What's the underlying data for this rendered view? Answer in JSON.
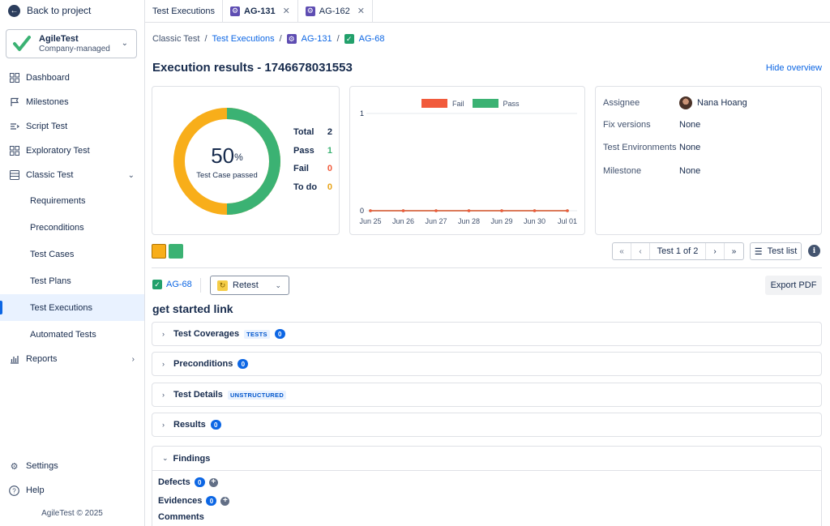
{
  "sidebar": {
    "back_label": "Back to project",
    "project_name": "AgileTest",
    "project_type": "Company-managed",
    "items": [
      {
        "label": "Dashboard",
        "icon": "dashboard-icon"
      },
      {
        "label": "Milestones",
        "icon": "flag-icon"
      },
      {
        "label": "Script Test",
        "icon": "script-icon"
      },
      {
        "label": "Exploratory Test",
        "icon": "grid-icon"
      },
      {
        "label": "Classic Test",
        "icon": "table-icon"
      }
    ],
    "sub_items": [
      "Requirements",
      "Preconditions",
      "Test Cases",
      "Test Plans",
      "Test Executions",
      "Automated Tests"
    ],
    "active_sub": "Test Executions",
    "reports_label": "Reports",
    "settings_label": "Settings",
    "help_label": "Help",
    "copyright": "AgileTest © 2025"
  },
  "tabs": [
    {
      "label": "Test Executions"
    },
    {
      "label": "AG-131"
    },
    {
      "label": "AG-162"
    }
  ],
  "breadcrumb": {
    "root": "Classic Test",
    "section": "Test Executions",
    "parent": "AG-131",
    "current": "AG-68"
  },
  "page": {
    "title": "Execution results - 1746678031553",
    "hide_overview": "Hide overview"
  },
  "summary": {
    "percent": "50",
    "percent_sign": "%",
    "caption": "Test Case passed",
    "total_label": "Total",
    "total": "2",
    "pass_label": "Pass",
    "pass": "1",
    "fail_label": "Fail",
    "fail": "0",
    "todo_label": "To do",
    "todo": "0",
    "colors": {
      "pass": "#3bb273",
      "fail": "#f15a3b",
      "todo": "#f8ae1a"
    }
  },
  "chart_data": {
    "type": "line",
    "x": [
      "Jun 25",
      "Jun 26",
      "Jun 27",
      "Jun 28",
      "Jun 29",
      "Jun 30",
      "Jul 01"
    ],
    "series": [
      {
        "name": "Fail",
        "values": [
          0,
          0,
          0,
          0,
          0,
          0,
          0
        ],
        "color": "#f15a3b"
      },
      {
        "name": "Pass",
        "values": [
          0,
          0,
          0,
          0,
          0,
          0,
          0
        ],
        "color": "#3bb273"
      }
    ],
    "yticks": [
      "0",
      "1"
    ],
    "ylim": [
      0,
      1
    ],
    "legend": "top",
    "grid": true
  },
  "info": {
    "assignee_label": "Assignee",
    "assignee": "Nana Hoang",
    "fix_versions_label": "Fix versions",
    "fix_versions": "None",
    "environments_label": "Test Environments",
    "environments": "None",
    "milestone_label": "Milestone",
    "milestone": "None"
  },
  "pager": {
    "text": "Test 1 of 2",
    "test_list": "Test list"
  },
  "detail": {
    "issue_key": "AG-68",
    "retest_label": "Retest",
    "export_label": "Export PDF",
    "name": "get started link"
  },
  "sections": [
    {
      "label": "Test Coverages",
      "tag": "TESTS",
      "count": "0"
    },
    {
      "label": "Preconditions",
      "count": "0"
    },
    {
      "label": "Test Details",
      "tag": "UNSTRUCTURED"
    },
    {
      "label": "Results",
      "count": "0"
    }
  ],
  "findings": {
    "label": "Findings",
    "defects_label": "Defects",
    "defects_count": "0",
    "evidences_label": "Evidences",
    "evidences_count": "0",
    "comments_label": "Comments"
  }
}
